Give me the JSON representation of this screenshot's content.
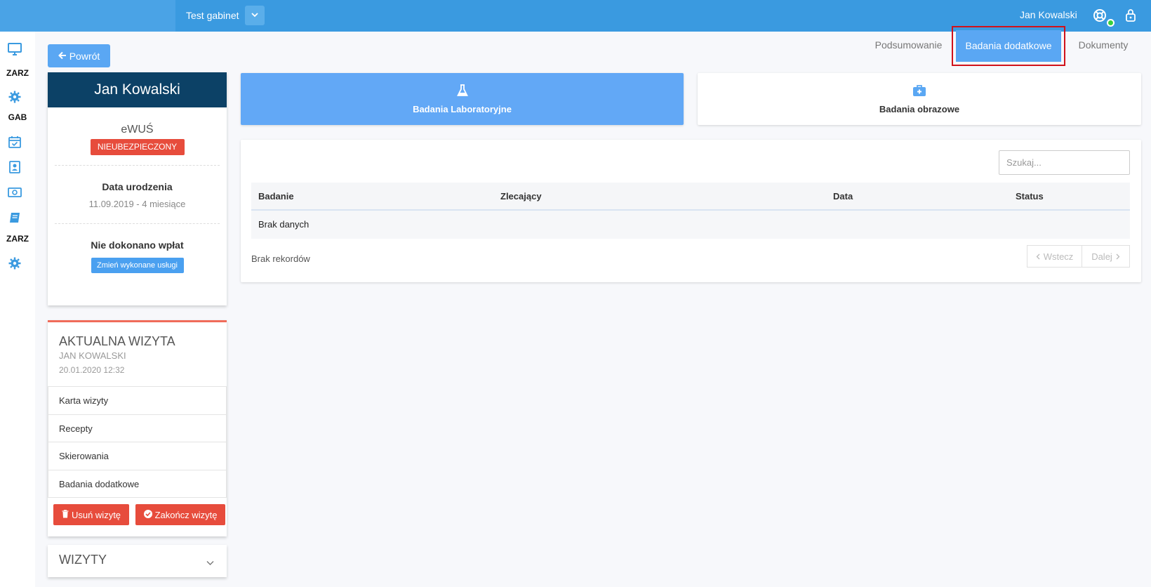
{
  "topbar": {
    "clinic_name": "Test gabinet",
    "user_name": "Jan Kowalski",
    "icons": [
      "chevron-down-icon",
      "lifebuoy-icon",
      "lock-icon"
    ],
    "status_color": "#36d13b"
  },
  "leftnav": {
    "labels": [
      "ZARZ",
      "GAB",
      "ZARZ"
    ],
    "icons": [
      "monitor-icon",
      "gear-icon",
      "calendar-check-icon",
      "contact-book-icon",
      "money-icon",
      "book-icon",
      "gear-icon"
    ]
  },
  "back_button": {
    "label": "Powrót"
  },
  "patient": {
    "name": "Jan Kowalski",
    "ewus_label": "eWUŚ",
    "ewus_status": "NIEUBEZPIECZONY",
    "dob_title": "Data urodzenia",
    "dob_value": "11.09.2019 - 4 miesiące",
    "payments_title": "Nie dokonano wpłat",
    "change_services_label": "Zmień wykonane usługi"
  },
  "current_visit": {
    "title": "AKTUALNA WIZYTA",
    "patient_name": "JAN KOWALSKI",
    "datetime": "20.01.2020 12:32",
    "menu": [
      "Karta wizyty",
      "Recepty",
      "Skierowania",
      "Badania dodatkowe"
    ],
    "delete_label": "Usuń wizytę",
    "finish_label": "Zakończ wizytę"
  },
  "visits": {
    "title": "WIZYTY"
  },
  "tabs": [
    {
      "label": "Podsumowanie",
      "active": false
    },
    {
      "label": "Badania dodatkowe",
      "active": true
    },
    {
      "label": "Dokumenty",
      "active": false
    }
  ],
  "categories": [
    {
      "label": "Badania Laboratoryjne",
      "icon": "flask-icon",
      "active": true
    },
    {
      "label": "Badania obrazowe",
      "icon": "medkit-icon",
      "active": false
    }
  ],
  "table": {
    "search_placeholder": "Szukaj...",
    "columns": [
      "Badanie",
      "Zlecający",
      "Data",
      "Status"
    ],
    "empty_text": "Brak danych",
    "records_text": "Brak rekordów",
    "prev_label": "Wstecz",
    "next_label": "Dalej"
  },
  "colors": {
    "topbar": "#3a9ae0",
    "accent": "#5aa7f3",
    "patient_header": "#0c4166",
    "danger": "#e74c3c",
    "highlight": "#d0121b"
  }
}
